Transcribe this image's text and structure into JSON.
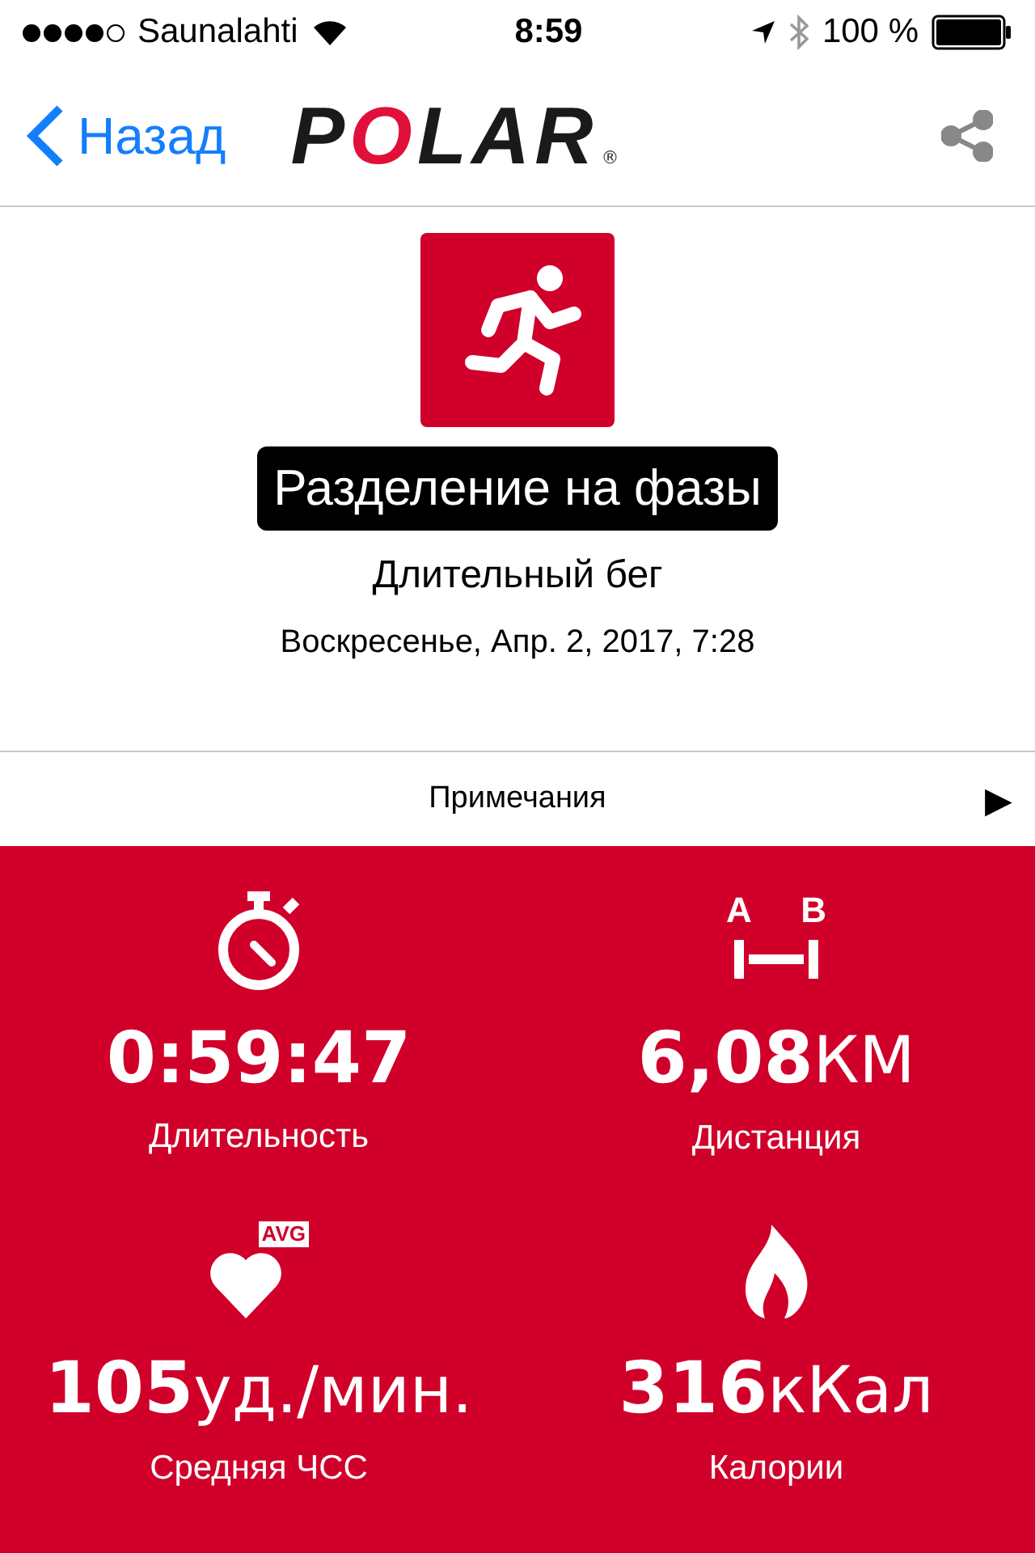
{
  "status_bar": {
    "carrier": "Saunalahti",
    "time": "8:59",
    "battery": "100 %"
  },
  "nav": {
    "back": "Назад",
    "logo": "POLAR",
    "logo_mark": "®"
  },
  "header": {
    "title": "Разделение на фазы",
    "sport": "Длительный бег",
    "date": "Воскресенье, Апр. 2, 2017, 7:28"
  },
  "notes": {
    "label": "Примечания",
    "arrow": "▶"
  },
  "stats": [
    {
      "kind": "duration",
      "value": "0:59:47",
      "label": "Длительность"
    },
    {
      "kind": "distance",
      "value": "6,08",
      "unit": "КМ",
      "label": "Дистанция",
      "icon_text": [
        "A",
        "B"
      ]
    },
    {
      "kind": "heart_rate",
      "value": "105",
      "unit": "уд./мин.",
      "label": "Средняя ЧСС",
      "icon_text": [
        "AVG"
      ]
    },
    {
      "kind": "calories",
      "value": "316",
      "unit": "кКал",
      "label": "Калории"
    }
  ]
}
